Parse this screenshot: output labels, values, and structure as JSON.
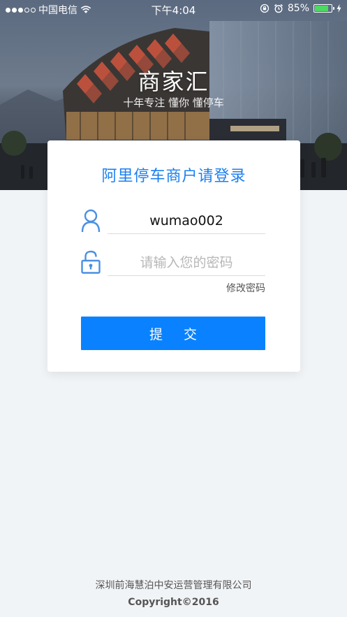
{
  "status_bar": {
    "carrier": "中国电信",
    "time": "下午4:04",
    "battery_percent": "85%",
    "battery_level": 0.85,
    "signal_bars_filled": 3,
    "signal_bars_total": 5
  },
  "brand": {
    "title": "商家汇",
    "subtitle": "十年专注 懂你 懂停车"
  },
  "login": {
    "title": "阿里停车商户请登录",
    "username_value": "wumao002",
    "password_placeholder": "请输入您的密码",
    "forgot_link": "修改密码",
    "submit_label": "提交"
  },
  "footer": {
    "company": "深圳前海慧泊中安运营管理有限公司",
    "copyright": "Copyright©2016"
  },
  "colors": {
    "accent": "#1a7ff0",
    "button": "#0a82ff",
    "background": "#f1f4f6"
  },
  "icons": [
    "wifi-icon",
    "rotation-lock-icon",
    "alarm-icon",
    "battery-icon",
    "charging-icon",
    "user-icon",
    "lock-icon"
  ]
}
